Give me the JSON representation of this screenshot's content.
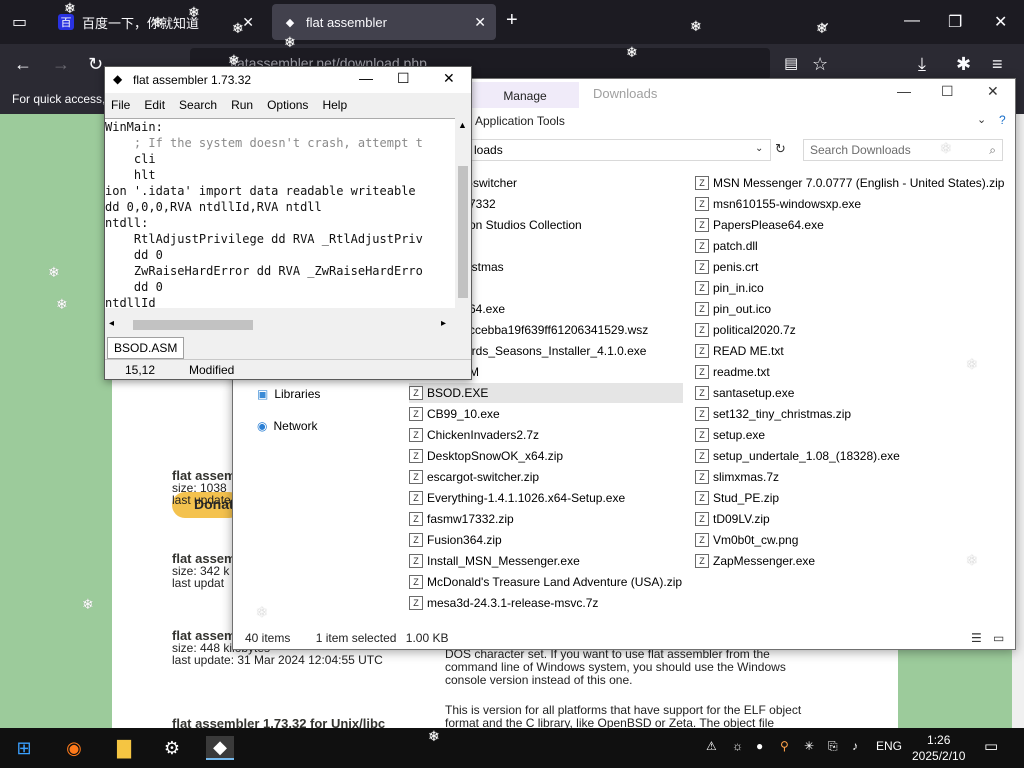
{
  "browser": {
    "tabs": [
      {
        "title": "百度一下，你就知道",
        "active": false
      },
      {
        "title": "flat assembler",
        "active": true
      }
    ],
    "url": "flatassembler.net/download.php",
    "bookmarks_text": "For quick access,"
  },
  "page": {
    "donate_label": "Donat",
    "downloads": [
      {
        "title": "flat assemb",
        "size": "size: 1038",
        "update": "last update"
      },
      {
        "title": "flat assem",
        "size": "size: 342 k",
        "update": "last updat"
      },
      {
        "title": "flat assem",
        "size": "size: 448 kilobytes",
        "update": "last update: 31 Mar 2024 12:04:55 UTC"
      },
      {
        "title": "flat assembler 1.73.32 for Unix/libc",
        "size": "",
        "update": ""
      }
    ],
    "desc1": "DOS character set. If you want to use flat assembler from the command line of Windows system, you should use the Windows console version instead of this one.",
    "desc2": "This is version for all platforms that have support for the ELF object format and the C library, like OpenBSD or Zeta. The object file"
  },
  "explorer": {
    "title": "Downloads",
    "ribbon_tab": "Manage",
    "ribbon_subtitle": "Application Tools",
    "address": "loads",
    "search_placeholder": "Search Downloads",
    "nav": [
      {
        "label": "Libraries",
        "icon": "libraries-icon"
      },
      {
        "label": "Network",
        "icon": "network-icon"
      }
    ],
    "col1": [
      "-switcher",
      "7332",
      "on Studios Collection",
      "",
      "istmas",
      "",
      "64.exe",
      "ccebba19f639ff61206341529.wsz",
      "irds_Seasons_Installer_4.1.0.exe",
      "M",
      "BSOD.EXE",
      "CB99_10.exe",
      "ChickenInvaders2.7z",
      "DesktopSnowOK_x64.zip",
      "escargot-switcher.zip",
      "Everything-1.4.1.1026.x64-Setup.exe",
      "fasmw17332.zip",
      "Fusion364.zip",
      "Install_MSN_Messenger.exe",
      "McDonald's Treasure Land Adventure (USA).zip",
      "mesa3d-24.3.1-release-msvc.7z"
    ],
    "col2": [
      "MSN Messenger 7.0.0777 (English - United States).zip",
      "msn610155-windowsxp.exe",
      "PapersPlease64.exe",
      "patch.dll",
      "penis.crt",
      "pin_in.ico",
      "pin_out.ico",
      "political2020.7z",
      "READ ME.txt",
      "readme.txt",
      "santasetup.exe",
      "set132_tiny_christmas.zip",
      "setup.exe",
      "setup_undertale_1.08_(18328).exe",
      "slimxmas.7z",
      "Stud_PE.zip",
      "tD09LV.zip",
      "Vm0b0t_cw.png",
      "ZapMessenger.exe"
    ],
    "status": {
      "count": "40 items",
      "selected": "1 item selected",
      "size": "1.00 KB"
    }
  },
  "fasm": {
    "title": "flat assembler 1.73.32",
    "menu": [
      "File",
      "Edit",
      "Search",
      "Run",
      "Options",
      "Help"
    ],
    "code_lines": [
      {
        "text": "WinMain:",
        "comment": false
      },
      {
        "text": "    ; If the system doesn't crash, attempt t",
        "comment": true
      },
      {
        "text": "    cli",
        "comment": false
      },
      {
        "text": "    hlt",
        "comment": false
      },
      {
        "text": "ion '.idata' import data readable writeable",
        "comment": false
      },
      {
        "text": "dd 0,0,0,RVA ntdllId,RVA ntdll",
        "comment": false
      },
      {
        "text": "ntdll:",
        "comment": false
      },
      {
        "text": "    RtlAdjustPrivilege dd RVA _RtlAdjustPriv",
        "comment": false
      },
      {
        "text": "    dd 0",
        "comment": false
      },
      {
        "text": "    ZwRaiseHardError dd RVA _ZwRaiseHardErro",
        "comment": false
      },
      {
        "text": "    dd 0",
        "comment": false
      },
      {
        "text": "ntdllId",
        "comment": false
      }
    ],
    "file_tab": "BSOD.ASM",
    "position": "15,12",
    "state": "Modified"
  },
  "taskbar": {
    "language": "ENG",
    "time": "1:26",
    "date": "2025/2/10"
  },
  "colors": {
    "page_bg": "#9ccb9b",
    "selection": "#cde8ff",
    "taskbar": "#101010"
  }
}
